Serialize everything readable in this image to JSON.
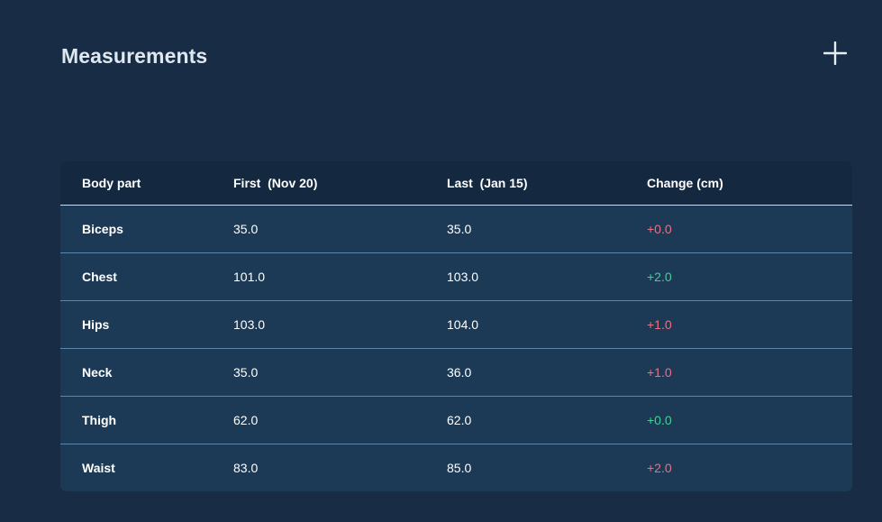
{
  "header": {
    "title": "Measurements",
    "add_icon": "plus-icon"
  },
  "table": {
    "columns": [
      "Body part",
      "First  (Nov 20)",
      "Last  (Jan 15)",
      "Change (cm)"
    ],
    "rows": [
      {
        "part": "Biceps",
        "first": "35.0",
        "last": "35.0",
        "change": "+0.0",
        "status": "neutral-red"
      },
      {
        "part": "Chest",
        "first": "101.0",
        "last": "103.0",
        "change": "+2.0",
        "status": "green"
      },
      {
        "part": "Hips",
        "first": "103.0",
        "last": "104.0",
        "change": "+1.0",
        "status": "red"
      },
      {
        "part": "Neck",
        "first": "35.0",
        "last": "36.0",
        "change": "+1.0",
        "status": "red"
      },
      {
        "part": "Thigh",
        "first": "62.0",
        "last": "62.0",
        "change": "+0.0",
        "status": "green"
      },
      {
        "part": "Waist",
        "first": "83.0",
        "last": "85.0",
        "change": "+2.0",
        "status": "red"
      }
    ]
  },
  "colors": {
    "background": "#182d45",
    "header_row": "#142840",
    "body_row": "#1c3a56",
    "change_red": "#ef6f82",
    "change_green": "#3fd48e"
  }
}
